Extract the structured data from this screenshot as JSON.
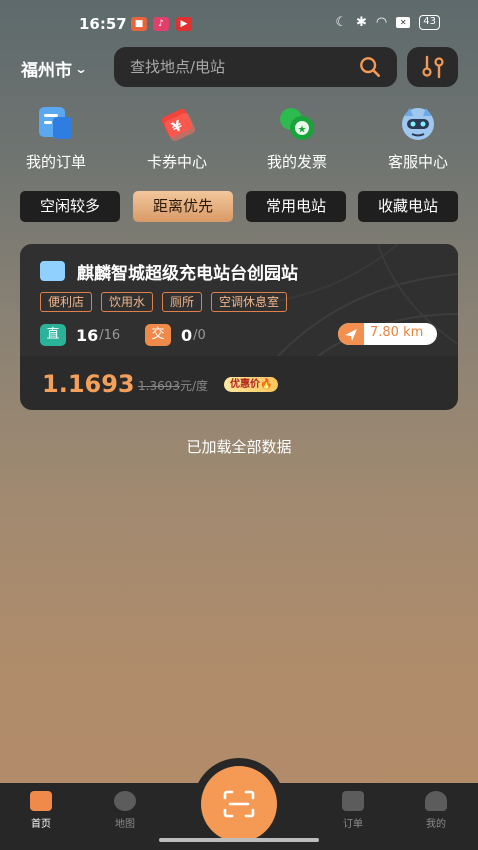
{
  "status_bar": {
    "time": "16:57",
    "battery": "43"
  },
  "header": {
    "city": "福州市",
    "search_placeholder": "查找地点/电站"
  },
  "quick_menu": [
    {
      "label": "我的订单",
      "icon": "order-icon"
    },
    {
      "label": "卡券中心",
      "icon": "coupon-icon"
    },
    {
      "label": "我的发票",
      "icon": "invoice-icon"
    },
    {
      "label": "客服中心",
      "icon": "customer-service-icon"
    }
  ],
  "filters": [
    "空闲较多",
    "距离优先",
    "常用电站",
    "收藏电站"
  ],
  "active_filter": "距离优先",
  "station": {
    "name": "麒麟智城超级充电站台创园站",
    "tags": [
      "便利店",
      "饮用水",
      "厕所",
      "空调休息室"
    ],
    "dc_label": "直",
    "dc_free": "16",
    "dc_total": "/16",
    "ac_label": "交",
    "ac_free": "0",
    "ac_total": "/0",
    "distance": "7.80 km",
    "price": "1.1693",
    "old_price": "1.3693",
    "unit": "元/度",
    "promo": "优惠价"
  },
  "loaded_text": "已加载全部数据",
  "bottom_nav": [
    {
      "label": "首页",
      "active": true
    },
    {
      "label": "地图",
      "active": false
    },
    {
      "label": "订单",
      "active": false
    },
    {
      "label": "我的",
      "active": false
    }
  ],
  "colors": {
    "accent": "#f59a54",
    "card": "#2b2b2b",
    "tag_border": "#e0804a",
    "price": "#f5a05a"
  }
}
